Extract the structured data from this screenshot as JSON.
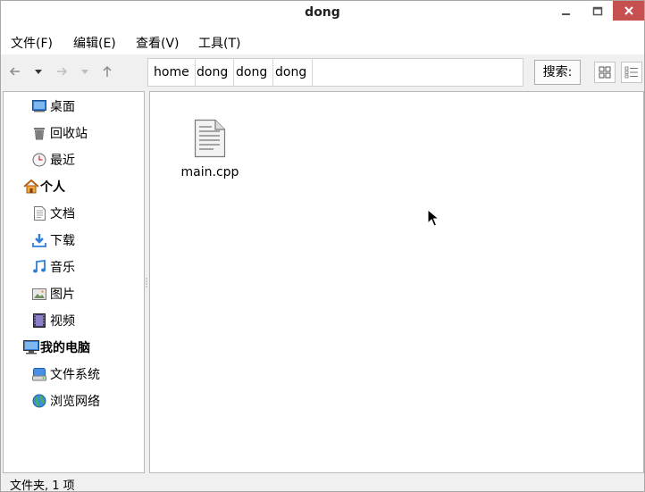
{
  "window": {
    "title": "dong"
  },
  "menu": [
    {
      "label": "文件(F)"
    },
    {
      "label": "编辑(E)"
    },
    {
      "label": "查看(V)"
    },
    {
      "label": "工具(T)"
    }
  ],
  "toolbar": {
    "breadcrumbs": [
      "home",
      "dong",
      "dong",
      "dong"
    ],
    "search_label": "搜索:"
  },
  "sidebar": {
    "places": [
      {
        "label": "桌面",
        "icon": "desktop-icon"
      },
      {
        "label": "回收站",
        "icon": "trash-icon"
      },
      {
        "label": "最近",
        "icon": "clock-icon"
      }
    ],
    "personal_heading": "个人",
    "personal": [
      {
        "label": "文档",
        "icon": "document-icon"
      },
      {
        "label": "下载",
        "icon": "download-icon"
      },
      {
        "label": "音乐",
        "icon": "music-icon"
      },
      {
        "label": "图片",
        "icon": "picture-icon"
      },
      {
        "label": "视频",
        "icon": "video-icon"
      }
    ],
    "computer_heading": "我的电脑",
    "computer": [
      {
        "label": "文件系统",
        "icon": "drive-icon"
      },
      {
        "label": "浏览网络",
        "icon": "globe-icon"
      }
    ]
  },
  "files": [
    {
      "name": "main.cpp",
      "icon": "text-file-icon"
    }
  ],
  "status": {
    "text": "文件夹, 1 项"
  },
  "colors": {
    "close_button": "#c75050",
    "accent_blue": "#2f7fd6"
  }
}
